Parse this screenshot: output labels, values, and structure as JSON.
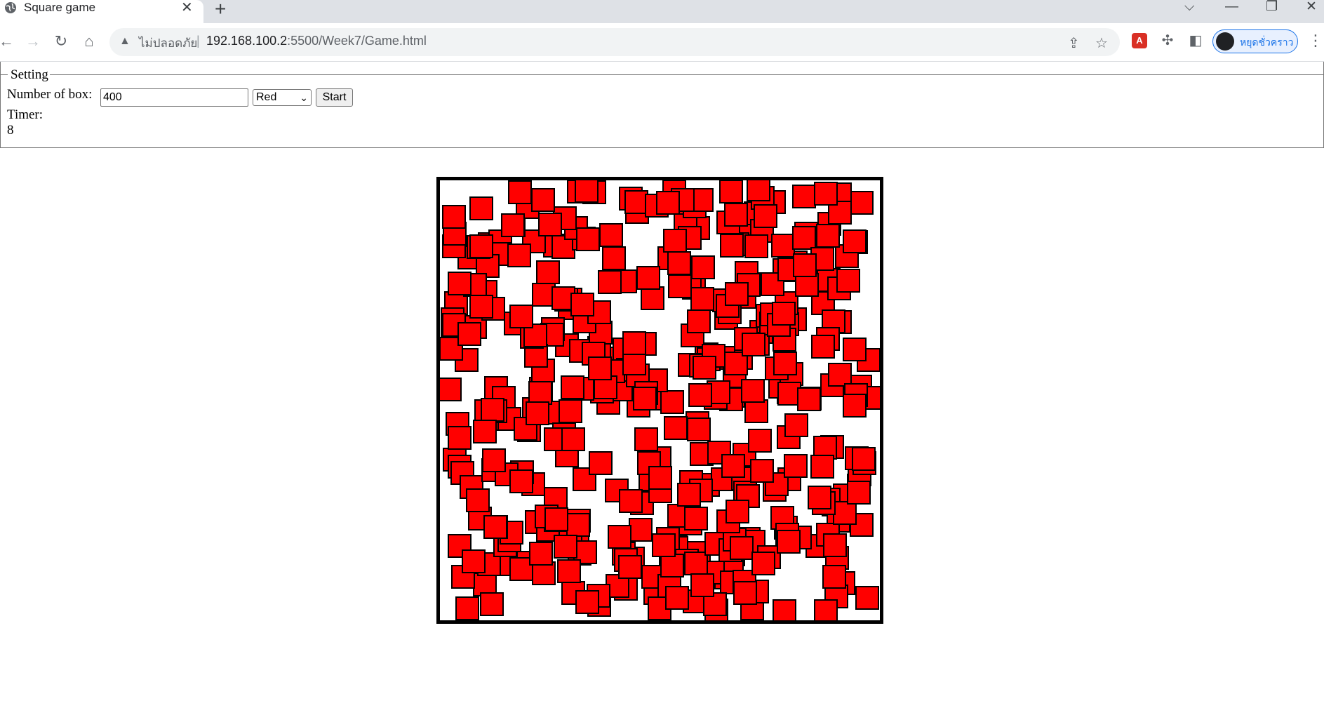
{
  "browser": {
    "tab_title": "Square game",
    "tab_close": "✕",
    "new_tab": "+",
    "window_controls": [
      "⌵",
      "—",
      "❐",
      "✕"
    ],
    "insecure_label": "ไม่ปลอดภัย",
    "url_host": "192.168.100.2",
    "url_rest": ":5500/Week7/Game.html",
    "profile_name": "หยุดชั่วคราว"
  },
  "setting": {
    "legend": "Setting",
    "number_label": "Number of box:",
    "number_value": "400",
    "color_selected": "Red",
    "start_label": "Start",
    "timer_label": "Timer:",
    "timer_value": "8"
  },
  "board": {
    "box_count": 400,
    "box_color": "#ff0000",
    "border_color": "#000000"
  }
}
